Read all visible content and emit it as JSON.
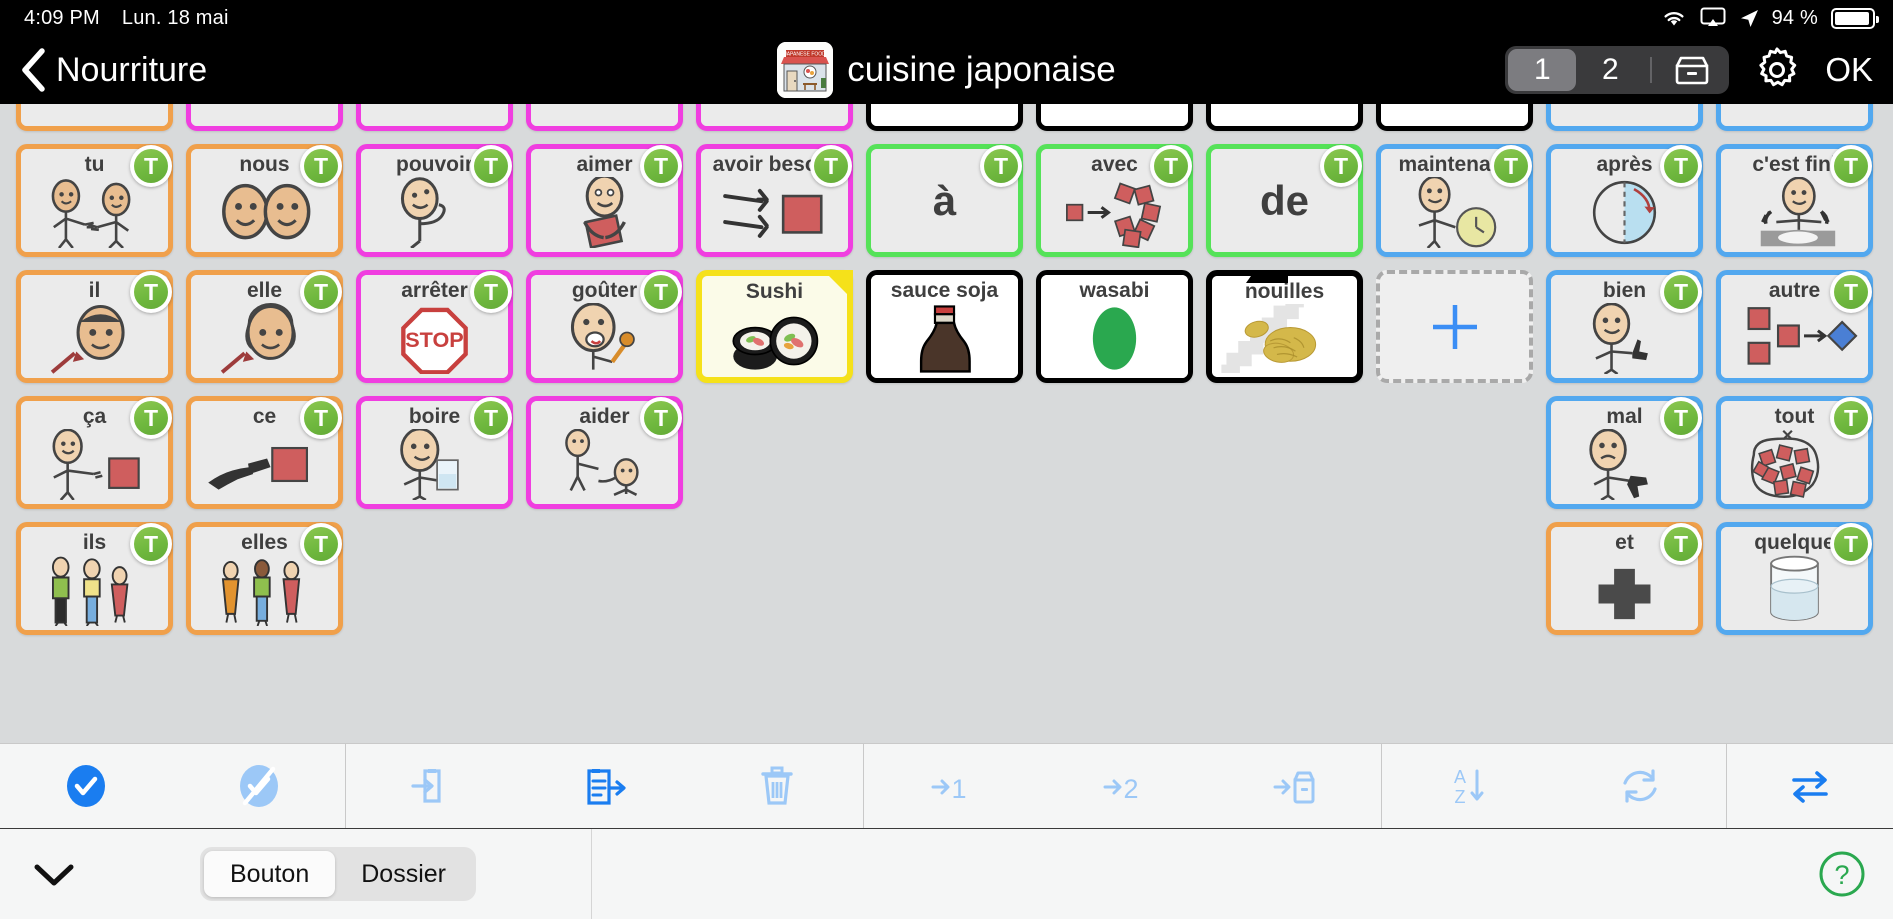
{
  "status_bar": {
    "time": "4:09 PM",
    "date": "Lun. 18 mai",
    "battery_percent": "94 %",
    "icons": [
      "wifi-icon",
      "airplay-icon",
      "location-arrow-icon",
      "battery-icon"
    ]
  },
  "header": {
    "back_label": "Nourriture",
    "title": "cuisine japonaise",
    "title_icon": "japanese-food-restaurant-icon",
    "page_1_label": "1",
    "page_2_label": "2",
    "archive_icon": "archive-tray-icon",
    "gear_icon": "gear-icon",
    "ok_label": "OK"
  },
  "grid": {
    "clipped_row": [
      {
        "color": "orange"
      },
      {
        "color": "pink"
      },
      {
        "color": "pink"
      },
      {
        "color": "pink"
      },
      {
        "color": "pink"
      },
      {
        "color": "black"
      },
      {
        "color": "black"
      },
      {
        "color": "black"
      },
      {
        "color": "black"
      },
      {
        "color": "blue"
      },
      {
        "color": "blue"
      }
    ],
    "rows": [
      [
        {
          "label": "tu",
          "color": "orange",
          "art": "two-people-pointing",
          "badge": "T"
        },
        {
          "label": "nous",
          "color": "orange",
          "art": "two-faces",
          "badge": "T"
        },
        {
          "label": "pouvoir",
          "color": "pink",
          "art": "person-flexing",
          "badge": "T"
        },
        {
          "label": "aimer",
          "color": "pink",
          "art": "person-hugging-square",
          "badge": "T"
        },
        {
          "label": "avoir besoin",
          "color": "pink",
          "art": "hands-reaching-square",
          "badge": "T"
        },
        {
          "label": "",
          "big_text": "à",
          "color": "green",
          "art": "none",
          "badge": "T"
        },
        {
          "label": "avec",
          "color": "green",
          "art": "square-joining-group",
          "badge": "T"
        },
        {
          "label": "",
          "big_text": "de",
          "color": "green",
          "art": "none",
          "badge": "T"
        },
        {
          "label": "maintenant",
          "color": "blue",
          "art": "person-pointing-clock",
          "badge": "T"
        },
        {
          "label": "après",
          "color": "blue",
          "art": "circle-half-shaded-arrow",
          "badge": "T"
        },
        {
          "label": "c'est fini",
          "color": "blue",
          "art": "person-empty-plate",
          "badge": "T"
        }
      ],
      [
        {
          "label": "il",
          "color": "orange",
          "art": "male-face-arrow",
          "badge": "T"
        },
        {
          "label": "elle",
          "color": "orange",
          "art": "female-face-arrow",
          "badge": "T"
        },
        {
          "label": "arrêter",
          "color": "pink",
          "art": "stop-sign",
          "badge": "T"
        },
        {
          "label": "goûter",
          "color": "pink",
          "art": "person-tasting",
          "badge": "T"
        },
        {
          "label": "Sushi",
          "color": "yellow",
          "art": "sushi-rolls",
          "badge": "",
          "folder": true
        },
        {
          "label": "sauce soja",
          "color": "black",
          "art": "soy-sauce-bottle",
          "badge": ""
        },
        {
          "label": "wasabi",
          "color": "black",
          "art": "wasabi-green-oval",
          "badge": ""
        },
        {
          "label": "nouilles",
          "color": "black",
          "art": "noodles",
          "badge": "",
          "folder": true
        },
        {
          "label": "",
          "color": "add",
          "art": "plus-icon",
          "badge": ""
        },
        {
          "label": "bien",
          "color": "blue",
          "art": "person-thumbs-up",
          "badge": "T"
        },
        {
          "label": "autre",
          "color": "blue",
          "art": "squares-arrow-diamond",
          "badge": "T"
        }
      ],
      [
        {
          "label": "ça",
          "color": "orange",
          "art": "person-pointing-square",
          "badge": "T"
        },
        {
          "label": "ce",
          "color": "orange",
          "art": "hand-pointing-square",
          "badge": "T"
        },
        {
          "label": "boire",
          "color": "pink",
          "art": "person-drinking-glass",
          "badge": "T"
        },
        {
          "label": "aider",
          "color": "pink",
          "art": "person-helping-person",
          "badge": "T"
        },
        {
          "label": "",
          "color": "blank"
        },
        {
          "label": "",
          "color": "blank"
        },
        {
          "label": "",
          "color": "blank"
        },
        {
          "label": "",
          "color": "blank"
        },
        {
          "label": "",
          "color": "blank"
        },
        {
          "label": "mal",
          "color": "blue",
          "art": "person-thumbs-down",
          "badge": "T"
        },
        {
          "label": "tout",
          "color": "blue",
          "art": "many-squares-bag",
          "badge": "T"
        }
      ],
      [
        {
          "label": "ils",
          "color": "orange",
          "art": "three-people-mixed",
          "badge": "T"
        },
        {
          "label": "elles",
          "color": "orange",
          "art": "three-women",
          "badge": "T"
        },
        {
          "label": "",
          "color": "blank"
        },
        {
          "label": "",
          "color": "blank"
        },
        {
          "label": "",
          "color": "blank"
        },
        {
          "label": "",
          "color": "blank"
        },
        {
          "label": "",
          "color": "blank"
        },
        {
          "label": "",
          "color": "blank"
        },
        {
          "label": "",
          "color": "blank"
        },
        {
          "label": "et",
          "color": "orange",
          "art": "plus-cross",
          "badge": "T"
        },
        {
          "label": "quelque",
          "color": "blue",
          "art": "glass-of-water",
          "badge": "T"
        }
      ]
    ]
  },
  "toolbar": {
    "buttons": [
      {
        "name": "select-all-icon",
        "enabled": true
      },
      {
        "name": "deselect-all-icon",
        "enabled": false
      },
      {
        "name": "import-into-icon",
        "enabled": false
      },
      {
        "name": "export-out-icon",
        "enabled": true
      },
      {
        "name": "trash-icon",
        "enabled": false
      },
      {
        "name": "move-to-page-1-icon",
        "label": "→1",
        "enabled": false
      },
      {
        "name": "move-to-page-2-icon",
        "label": "→2",
        "enabled": false
      },
      {
        "name": "move-to-archive-icon",
        "enabled": false
      },
      {
        "name": "sort-az-icon",
        "enabled": false
      },
      {
        "name": "refresh-icon",
        "enabled": false
      },
      {
        "name": "swap-icon",
        "enabled": true
      }
    ]
  },
  "bottom_bar": {
    "collapse_icon": "chevron-down-icon",
    "mode_button": "Bouton",
    "mode_folder": "Dossier",
    "selected_mode": "Bouton",
    "help_icon": "question-mark-icon"
  },
  "colors": {
    "orange": "#f0a04b",
    "pink": "#f03ee0",
    "green": "#55e258",
    "blue": "#52a8ef",
    "yellow": "#f5e11a",
    "black": "#000000",
    "accent_blue": "#1a7df0",
    "badge_green": "#6fb83e"
  }
}
